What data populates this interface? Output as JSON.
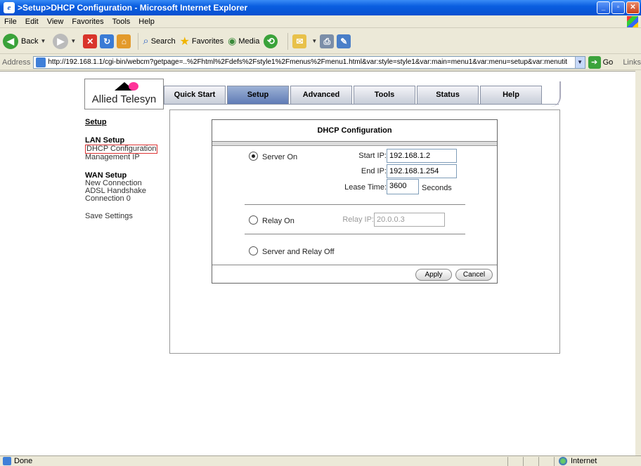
{
  "window": {
    "title": ">Setup>DHCP Configuration - Microsoft Internet Explorer"
  },
  "menu": {
    "items": [
      "File",
      "Edit",
      "View",
      "Favorites",
      "Tools",
      "Help"
    ]
  },
  "toolbar": {
    "back": "Back",
    "search": "Search",
    "favorites": "Favorites",
    "media": "Media"
  },
  "address": {
    "label": "Address",
    "url": "http://192.168.1.1/cgi-bin/webcm?getpage=..%2Fhtml%2Fdefs%2Fstyle1%2Fmenus%2Fmenu1.html&var:style=style1&var:main=menu1&var:menu=setup&var:menutit",
    "go": "Go",
    "links": "Links"
  },
  "status": {
    "text": "Done",
    "zone": "Internet"
  },
  "brand": {
    "logo_text": "Allied Telesyn"
  },
  "nav": {
    "tabs": [
      "Quick Start",
      "Setup",
      "Advanced",
      "Tools",
      "Status",
      "Help"
    ],
    "active": "Setup"
  },
  "sidebar": {
    "heading": "Setup",
    "lan_heading": "LAN Setup",
    "lan_items": [
      "DHCP Configuration",
      "Management IP"
    ],
    "wan_heading": "WAN Setup",
    "wan_items": [
      "New Connection",
      "ADSL Handshake",
      "Connection 0"
    ],
    "save": "Save Settings"
  },
  "dialog": {
    "title": "DHCP Configuration",
    "server_on": "Server On",
    "start_ip_label": "Start IP:",
    "start_ip": "192.168.1.2",
    "end_ip_label": "End IP:",
    "end_ip": "192.168.1.254",
    "lease_label": "Lease Time:",
    "lease": "3600",
    "lease_unit": "Seconds",
    "relay_on": "Relay On",
    "relay_ip_label": "Relay IP:",
    "relay_ip": "20.0.0.3",
    "off": "Server and Relay Off",
    "apply": "Apply",
    "cancel": "Cancel",
    "selected": "Server On"
  }
}
